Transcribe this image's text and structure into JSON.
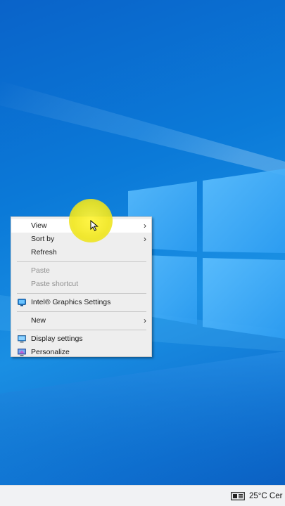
{
  "context_menu": {
    "items": [
      {
        "label": "View",
        "has_submenu": true
      },
      {
        "label": "Sort by",
        "has_submenu": true
      },
      {
        "label": "Refresh"
      },
      {
        "label": "Paste"
      },
      {
        "label": "Paste shortcut"
      },
      {
        "label": "Intel® Graphics Settings",
        "icon": "intel-graphics-icon"
      },
      {
        "label": "New",
        "has_submenu": true
      },
      {
        "label": "Display settings",
        "icon": "display-icon"
      },
      {
        "label": "Personalize",
        "icon": "personalize-icon"
      }
    ]
  },
  "taskbar": {
    "weather_text": "25°C  Cer",
    "weather_icon": "news-weather-icon"
  },
  "colors": {
    "desktop_blue": "#0b7ad8",
    "menu_bg": "#eeeeee",
    "cursor_highlight": "#f4ec2a"
  }
}
